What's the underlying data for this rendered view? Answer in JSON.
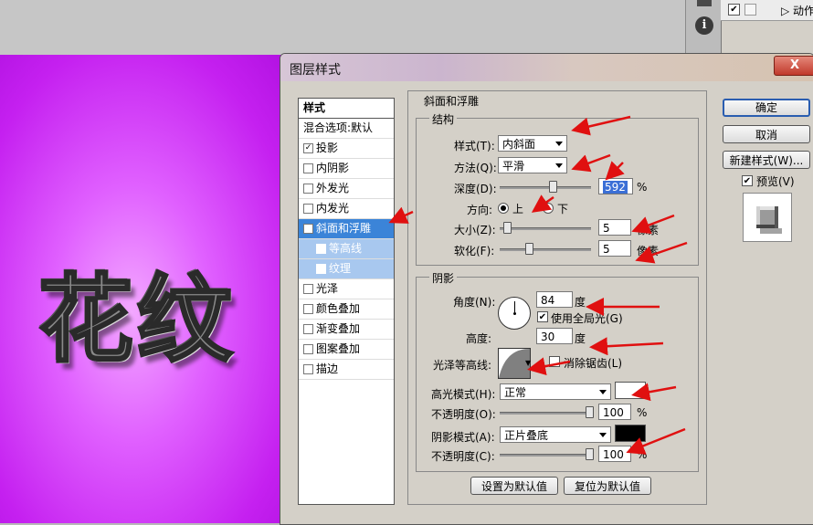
{
  "canvas": {
    "artwork_text": "花纹",
    "background_color": "#c520f0"
  },
  "layers_panel": {
    "info_icon": "i",
    "row_label": "▷ 动作"
  },
  "dialog": {
    "title": "图层样式",
    "close_label": "X",
    "styles_list": {
      "header": "样式",
      "blend_options": "混合选项:默认",
      "items": [
        {
          "label": "投影",
          "checked": true
        },
        {
          "label": "内阴影",
          "checked": false
        },
        {
          "label": "外发光",
          "checked": false
        },
        {
          "label": "内发光",
          "checked": false
        },
        {
          "label": "斜面和浮雕",
          "checked": true,
          "selected": true
        },
        {
          "label": "等高线",
          "checked": false,
          "sub": true
        },
        {
          "label": "纹理",
          "checked": false,
          "sub": true
        },
        {
          "label": "光泽",
          "checked": false
        },
        {
          "label": "颜色叠加",
          "checked": false
        },
        {
          "label": "渐变叠加",
          "checked": false
        },
        {
          "label": "图案叠加",
          "checked": false
        },
        {
          "label": "描边",
          "checked": false
        }
      ]
    },
    "bevel": {
      "group_title": "斜面和浮雕",
      "structure_title": "结构",
      "style_label": "样式(T):",
      "style_value": "内斜面",
      "technique_label": "方法(Q):",
      "technique_value": "平滑",
      "depth_label": "深度(D):",
      "depth_value": "592",
      "percent": "%",
      "direction_label": "方向:",
      "direction_up": "上",
      "direction_down": "下",
      "size_label": "大小(Z):",
      "size_value": "5",
      "size_unit": "像素",
      "soften_label": "软化(F):",
      "soften_value": "5",
      "soften_unit": "像素"
    },
    "shading": {
      "title": "阴影",
      "angle_label": "角度(N):",
      "angle_value": "84",
      "angle_unit": "度",
      "global_light_label": "使用全局光(G)",
      "altitude_label": "高度:",
      "altitude_value": "30",
      "altitude_unit": "度",
      "gloss_contour_label": "光泽等高线:",
      "antialiased_label": "消除锯齿(L)",
      "highlight_mode_label": "高光模式(H):",
      "highlight_mode_value": "正常",
      "highlight_color": "#ffffff",
      "highlight_opacity_label": "不透明度(O):",
      "highlight_opacity_value": "100",
      "shadow_mode_label": "阴影模式(A):",
      "shadow_mode_value": "正片叠底",
      "shadow_color": "#000000",
      "shadow_opacity_label": "不透明度(C):",
      "shadow_opacity_value": "100",
      "percent": "%"
    },
    "buttons": {
      "make_default": "设置为默认值",
      "reset_default": "复位为默认值",
      "ok": "确定",
      "cancel": "取消",
      "new_style": "新建样式(W)...",
      "preview": "预览(V)"
    }
  },
  "annotation_color": "#e01010"
}
